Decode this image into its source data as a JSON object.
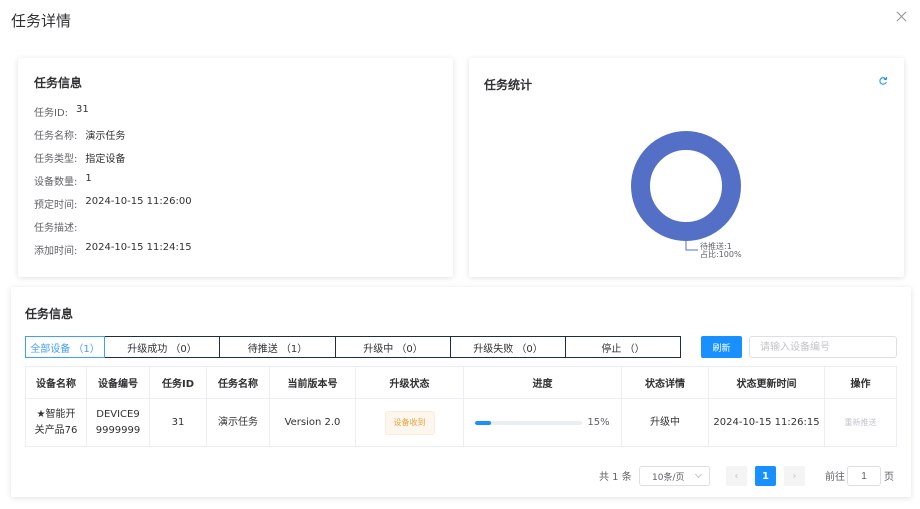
{
  "dialog": {
    "title": "任务详情"
  },
  "info_card": {
    "title": "任务信息",
    "rows": [
      {
        "key": "任务ID:",
        "value": "31"
      },
      {
        "key": "任务名称:",
        "value": "演示任务"
      },
      {
        "key": "任务类型:",
        "value": "指定设备"
      },
      {
        "key": "设备数量:",
        "value": "1"
      },
      {
        "key": "预定时间:",
        "value": "2024-10-15 11:26:00"
      },
      {
        "key": "任务描述:",
        "value": ""
      },
      {
        "key": "添加时间:",
        "value": "2024-10-15 11:24:15"
      }
    ]
  },
  "stats_card": {
    "title": "任务统计",
    "refresh_icon": "refresh-icon",
    "color": "#5470c6",
    "label_line1": "待推送:1",
    "label_line2": "占比:100%"
  },
  "chart_data": {
    "type": "pie",
    "donut": true,
    "slices": [
      {
        "name": "待推送",
        "value": 1,
        "percent": 100
      }
    ]
  },
  "device_section": {
    "title": "任务信息",
    "tabs": [
      {
        "label": "全部设备 （1）",
        "active": true
      },
      {
        "label": "升级成功 （0）",
        "active": false
      },
      {
        "label": "待推送 （1）",
        "active": false
      },
      {
        "label": "升级中 （0）",
        "active": false
      },
      {
        "label": "升级失败 （0）",
        "active": false
      },
      {
        "label": "停止 （）",
        "active": false
      }
    ],
    "refresh_button": "刷新",
    "search_placeholder": "请输入设备编号",
    "columns": [
      "设备名称",
      "设备编号",
      "任务ID",
      "任务名称",
      "当前版本号",
      "升级状态",
      "进度",
      "状态详情",
      "状态更新时间",
      "操作"
    ],
    "rows": [
      {
        "name": "★智能开关产品76",
        "code": "DEVICE99999999",
        "task_id": "31",
        "task_name": "演示任务",
        "version": "Version 2.0",
        "status": "设备收到",
        "progress": 15,
        "progress_text": "15%",
        "detail": "升级中",
        "updated": "2024-10-15 11:26:15",
        "action": "重新推送"
      }
    ],
    "pagination": {
      "total": "共 1 条",
      "page_size": "10条/页",
      "prev": "‹",
      "next": "›",
      "current": "1",
      "goto_label": "前往",
      "goto_value": "1",
      "page_unit": "页"
    }
  }
}
